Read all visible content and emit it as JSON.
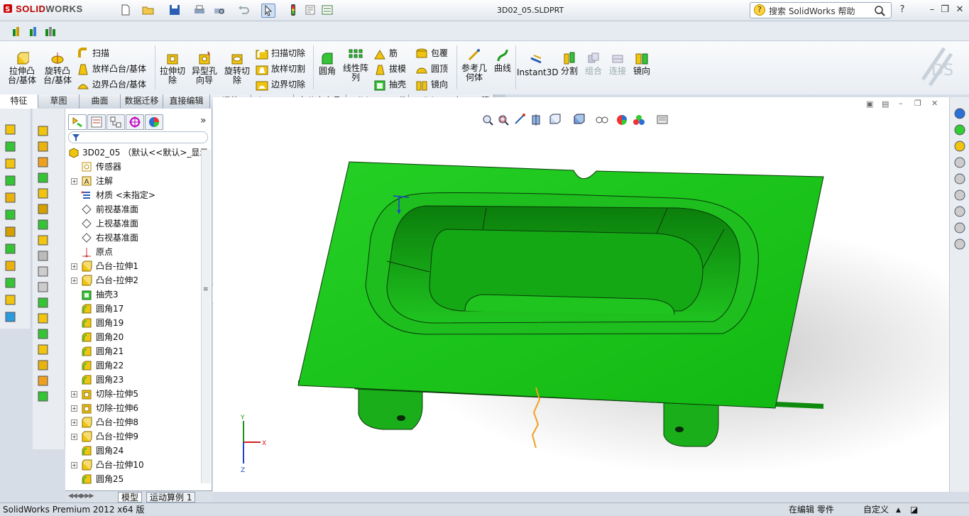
{
  "app": {
    "brand_a": "SOLID",
    "brand_b": "WORKS",
    "document_title": "3D02_05.SLDPRT"
  },
  "help": {
    "placeholder": "搜索 SolidWorks 帮助",
    "q": "?"
  },
  "window_controls": {
    "help": "?",
    "minimize": "–",
    "restore": "❐",
    "close": "✕"
  },
  "command_manager": {
    "extrude_boss": "拉伸凸\n台/基体",
    "revolve_boss": "旋转凸\n台/基体",
    "sweep": "扫描",
    "loft": "放样凸台/基体",
    "boundary": "边界凸台/基体",
    "extrude_cut": "拉伸切\n除",
    "hole_wizard": "异型孔\n向导",
    "revolve_cut": "旋转切\n除",
    "sweep_cut": "扫描切除",
    "loft_cut": "放样切割",
    "boundary_cut": "边界切除",
    "fillet": "圆角",
    "linear_pattern": "线性阵\n列",
    "rib": "筋",
    "draft": "拔模",
    "shell": "抽壳",
    "wrap": "包覆",
    "dome": "圆顶",
    "mirror": "镜向",
    "ref_geometry": "参考几\n何体",
    "curves": "曲线",
    "instant3d": "Instant3D",
    "split": "分割",
    "combine": "组合",
    "join": "连接",
    "mirror2": "镜向"
  },
  "tabs": [
    "特征",
    "草图",
    "曲面",
    "数据迁移",
    "直接编辑",
    "评估",
    "DimXpert",
    "办公室产品",
    "SolidCAM 工件",
    "SolidCAM 加工工程"
  ],
  "feature_tree": {
    "root": "3D02_05 （默认<<默认>_显示",
    "items": [
      {
        "label": "传感器",
        "expand": false,
        "icon": "sensor"
      },
      {
        "label": "注解",
        "expand": true,
        "icon": "annotation"
      },
      {
        "label": "材质 <未指定>",
        "expand": false,
        "icon": "material"
      },
      {
        "label": "前视基准面",
        "expand": false,
        "icon": "plane"
      },
      {
        "label": "上视基准面",
        "expand": false,
        "icon": "plane"
      },
      {
        "label": "右视基准面",
        "expand": false,
        "icon": "plane"
      },
      {
        "label": "原点",
        "expand": false,
        "icon": "origin"
      },
      {
        "label": "凸台-拉伸1",
        "expand": true,
        "icon": "boss"
      },
      {
        "label": "凸台-拉伸2",
        "expand": true,
        "icon": "boss"
      },
      {
        "label": "抽壳3",
        "expand": false,
        "icon": "shell"
      },
      {
        "label": "圆角17",
        "expand": false,
        "icon": "fillet"
      },
      {
        "label": "圆角19",
        "expand": false,
        "icon": "fillet"
      },
      {
        "label": "圆角20",
        "expand": false,
        "icon": "fillet"
      },
      {
        "label": "圆角21",
        "expand": false,
        "icon": "fillet"
      },
      {
        "label": "圆角22",
        "expand": false,
        "icon": "fillet"
      },
      {
        "label": "圆角23",
        "expand": false,
        "icon": "fillet"
      },
      {
        "label": "切除-拉伸5",
        "expand": true,
        "icon": "cut"
      },
      {
        "label": "切除-拉伸6",
        "expand": true,
        "icon": "cut"
      },
      {
        "label": "凸台-拉伸8",
        "expand": true,
        "icon": "boss"
      },
      {
        "label": "凸台-拉伸9",
        "expand": true,
        "icon": "boss"
      },
      {
        "label": "圆角24",
        "expand": false,
        "icon": "fillet"
      },
      {
        "label": "凸台-拉伸10",
        "expand": true,
        "icon": "boss"
      },
      {
        "label": "圆角25",
        "expand": false,
        "icon": "fillet"
      }
    ]
  },
  "bottom_tabs": {
    "model": "模型",
    "motion": "运动算例 1"
  },
  "triad": {
    "x": "X",
    "y": "Y",
    "z": "Z"
  },
  "status": {
    "product": "SolidWorks Premium 2012 x64 版",
    "editing": "在编辑 零件",
    "custom": "自定义"
  },
  "colors": {
    "part_green": "#1ec81e",
    "part_edge": "#0a3a0a",
    "accent": "#f0a020"
  }
}
